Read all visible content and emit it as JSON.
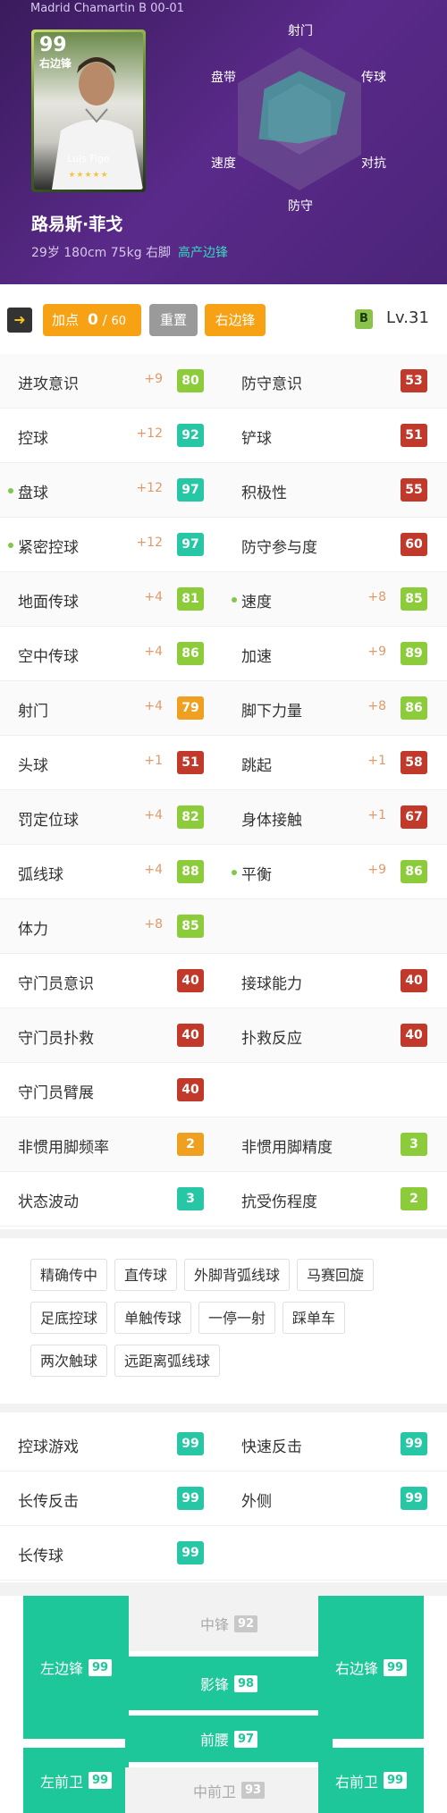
{
  "header": {
    "club": "Madrid Chamartin B 00-01",
    "card": {
      "rating": "99",
      "position": "右边锋",
      "name": "Luis Figo",
      "stars": "★★★★★"
    },
    "player_name": "路易斯·菲戈",
    "info": "29岁 180cm 75kg 右脚",
    "role": "高产边锋",
    "radar_labels": {
      "top": "射门",
      "top_right": "传球",
      "bottom_right": "对抗",
      "bottom": "防守",
      "bottom_left": "速度",
      "top_left": "盘带"
    }
  },
  "toolbar": {
    "add_label": "加点",
    "add_value": "0",
    "add_max": "60",
    "reset_label": "重置",
    "position_label": "右边锋",
    "lv_badge": "B",
    "lv_text": "Lv.31"
  },
  "colors": {
    "green_light": "#8ccc3a",
    "teal": "#27c7a6",
    "orange": "#f0a020",
    "red": "#c0392b"
  },
  "stats": [
    [
      {
        "label": "进攻意识",
        "boost": "+9",
        "value": "80",
        "color": "#8ccc3a",
        "dot": false
      },
      {
        "label": "防守意识",
        "boost": "",
        "value": "53",
        "color": "#c0392b",
        "dot": false
      }
    ],
    [
      {
        "label": "控球",
        "boost": "+12",
        "value": "92",
        "color": "#27c7a6",
        "dot": false
      },
      {
        "label": "铲球",
        "boost": "",
        "value": "51",
        "color": "#c0392b",
        "dot": false
      }
    ],
    [
      {
        "label": "盘球",
        "boost": "+12",
        "value": "97",
        "color": "#27c7a6",
        "dot": true
      },
      {
        "label": "积极性",
        "boost": "",
        "value": "55",
        "color": "#c0392b",
        "dot": false
      }
    ],
    [
      {
        "label": "紧密控球",
        "boost": "+12",
        "value": "97",
        "color": "#27c7a6",
        "dot": true
      },
      {
        "label": "防守参与度",
        "boost": "",
        "value": "60",
        "color": "#c0392b",
        "dot": false
      }
    ],
    [
      {
        "label": "地面传球",
        "boost": "+4",
        "value": "81",
        "color": "#8ccc3a",
        "dot": false
      },
      {
        "label": "速度",
        "boost": "+8",
        "value": "85",
        "color": "#8ccc3a",
        "dot": true
      }
    ],
    [
      {
        "label": "空中传球",
        "boost": "+4",
        "value": "86",
        "color": "#8ccc3a",
        "dot": false
      },
      {
        "label": "加速",
        "boost": "+9",
        "value": "89",
        "color": "#8ccc3a",
        "dot": false
      }
    ],
    [
      {
        "label": "射门",
        "boost": "+4",
        "value": "79",
        "color": "#f0a020",
        "dot": false
      },
      {
        "label": "脚下力量",
        "boost": "+8",
        "value": "86",
        "color": "#8ccc3a",
        "dot": false
      }
    ],
    [
      {
        "label": "头球",
        "boost": "+1",
        "value": "51",
        "color": "#c0392b",
        "dot": false
      },
      {
        "label": "跳起",
        "boost": "+1",
        "value": "58",
        "color": "#c0392b",
        "dot": false
      }
    ],
    [
      {
        "label": "罚定位球",
        "boost": "+4",
        "value": "82",
        "color": "#8ccc3a",
        "dot": false
      },
      {
        "label": "身体接触",
        "boost": "+1",
        "value": "67",
        "color": "#c0392b",
        "dot": false
      }
    ],
    [
      {
        "label": "弧线球",
        "boost": "+4",
        "value": "88",
        "color": "#8ccc3a",
        "dot": false
      },
      {
        "label": "平衡",
        "boost": "+9",
        "value": "86",
        "color": "#8ccc3a",
        "dot": true
      }
    ],
    [
      {
        "label": "体力",
        "boost": "+8",
        "value": "85",
        "color": "#8ccc3a",
        "dot": false
      },
      null
    ],
    [
      {
        "label": "守门员意识",
        "boost": "",
        "value": "40",
        "color": "#c0392b",
        "dot": false
      },
      {
        "label": "接球能力",
        "boost": "",
        "value": "40",
        "color": "#c0392b",
        "dot": false
      }
    ],
    [
      {
        "label": "守门员扑救",
        "boost": "",
        "value": "40",
        "color": "#c0392b",
        "dot": false
      },
      {
        "label": "扑救反应",
        "boost": "",
        "value": "40",
        "color": "#c0392b",
        "dot": false
      }
    ],
    [
      {
        "label": "守门员臂展",
        "boost": "",
        "value": "40",
        "color": "#c0392b",
        "dot": false
      },
      null
    ],
    [
      {
        "label": "非惯用脚频率",
        "boost": "",
        "value": "2",
        "color": "#f0a020",
        "dot": false
      },
      {
        "label": "非惯用脚精度",
        "boost": "",
        "value": "3",
        "color": "#8ccc3a",
        "dot": false
      }
    ],
    [
      {
        "label": "状态波动",
        "boost": "",
        "value": "3",
        "color": "#27c7a6",
        "dot": false
      },
      {
        "label": "抗受伤程度",
        "boost": "",
        "value": "2",
        "color": "#8ccc3a",
        "dot": false
      }
    ]
  ],
  "skills": [
    "精确传中",
    "直传球",
    "外脚背弧线球",
    "马赛回旋",
    "足底控球",
    "单触传球",
    "一停一射",
    "踩单车",
    "两次触球",
    "远距离弧线球"
  ],
  "play_styles": [
    [
      {
        "label": "控球游戏",
        "value": "99"
      },
      {
        "label": "快速反击",
        "value": "99"
      }
    ],
    [
      {
        "label": "长传反击",
        "value": "99"
      },
      {
        "label": "外侧",
        "value": "99"
      }
    ],
    [
      {
        "label": "长传球",
        "value": "99"
      },
      null
    ]
  ],
  "positions": [
    {
      "label": "中锋",
      "value": "92",
      "active": false
    },
    {
      "label": "左边锋",
      "value": "99",
      "active": true
    },
    {
      "label": "影锋",
      "value": "98",
      "active": true
    },
    {
      "label": "右边锋",
      "value": "99",
      "active": true
    },
    {
      "label": "前腰",
      "value": "97",
      "active": true
    },
    {
      "label": "左前卫",
      "value": "99",
      "active": true
    },
    {
      "label": "中前卫",
      "value": "93",
      "active": false
    },
    {
      "label": "右前卫",
      "value": "99",
      "active": true
    }
  ]
}
